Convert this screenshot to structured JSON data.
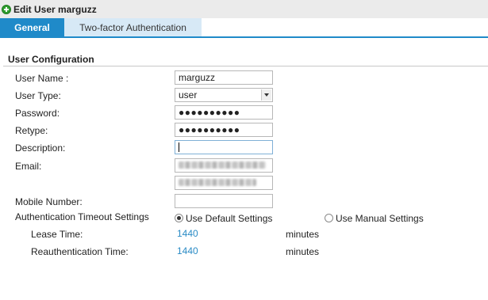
{
  "window": {
    "title": "Edit User marguzz",
    "icon": "plus-circle-icon"
  },
  "tabs": [
    {
      "label": "General",
      "active": true
    },
    {
      "label": "Two-factor Authentication",
      "active": false
    }
  ],
  "section": {
    "title": "User Configuration"
  },
  "form": {
    "user_name": {
      "label": "User Name :",
      "value": "marguzz"
    },
    "user_type": {
      "label": "User Type:",
      "value": "user"
    },
    "password": {
      "label": "Password:",
      "value": "●●●●●●●●●●"
    },
    "retype": {
      "label": "Retype:",
      "value": "●●●●●●●●●●"
    },
    "description": {
      "label": "Description:",
      "value": ""
    },
    "email": {
      "label": "Email:",
      "value_1": "(redacted)",
      "value_2": "(redacted)"
    },
    "mobile": {
      "label": "Mobile Number:",
      "value": ""
    },
    "auth_timeout": {
      "label": "Authentication Timeout Settings",
      "option_default": "Use Default Settings",
      "option_manual": "Use Manual Settings",
      "selected": "default",
      "lease_time": {
        "label": "Lease Time:",
        "value": "1440",
        "unit": "minutes"
      },
      "reauth_time": {
        "label": "Reauthentication Time:",
        "value": "1440",
        "unit": "minutes"
      }
    }
  },
  "colors": {
    "accent": "#1f8ac9",
    "tab_inactive": "#d7e9f6",
    "link_value": "#2a8bc5",
    "title_bar": "#ebebeb"
  }
}
